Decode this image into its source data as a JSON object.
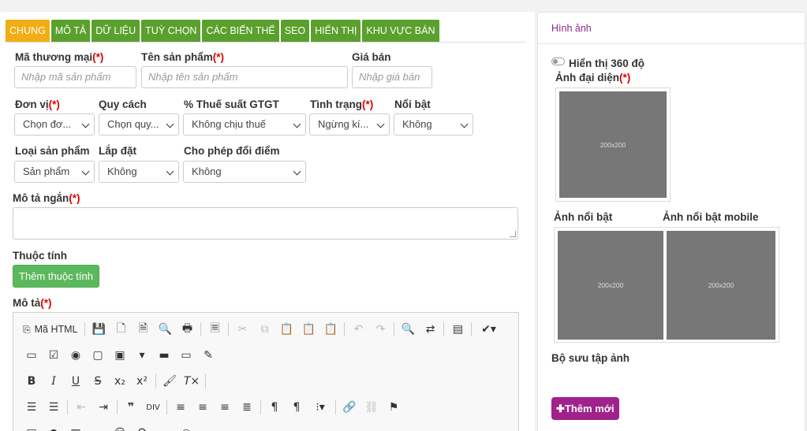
{
  "tabs": [
    {
      "label": "CHUNG"
    },
    {
      "label": "MÔ TẢ"
    },
    {
      "label": "DỮ LIỆU"
    },
    {
      "label": "TUỲ CHỌN"
    },
    {
      "label": "CÁC BIẾN THỂ"
    },
    {
      "label": "SEO"
    },
    {
      "label": "HIỂN THỊ"
    },
    {
      "label": "KHU VỰC BÁN"
    }
  ],
  "required_mark": "(*)",
  "fields": {
    "sku": {
      "label": "Mã thương mại",
      "placeholder": "Nhập mã sản phẩm"
    },
    "name": {
      "label": "Tên sản phẩm",
      "placeholder": "Nhập tên sản phẩm"
    },
    "price": {
      "label": "Giá bán",
      "placeholder": "Nhập giá bán"
    },
    "unit": {
      "label": "Đơn vị",
      "value": "Chọn đơ..."
    },
    "spec": {
      "label": "Quy cách",
      "value": "Chọn quy..."
    },
    "vat": {
      "label": "% Thuế suất GTGT",
      "value": "Không chịu thuế"
    },
    "status": {
      "label": "Tình trạng",
      "value": "Ngừng kí..."
    },
    "featured": {
      "label": "Nổi bật",
      "value": "Không"
    },
    "product_type": {
      "label": "Loại sản phẩm",
      "value": "Sản phẩm"
    },
    "install": {
      "label": "Lắp đặt",
      "value": "Không"
    },
    "points": {
      "label": "Cho phép đổi điểm",
      "value": "Không"
    },
    "short_desc": {
      "label": "Mô tả ngắn"
    },
    "attributes": {
      "label": "Thuộc tính",
      "button": "Thêm thuộc tính"
    },
    "description": {
      "label": "Mô tả"
    }
  },
  "editor": {
    "source_label": "Mã HTML"
  },
  "images": {
    "panel_title": "Hình ảnh",
    "toggle_360": "Hiển thị 360 độ",
    "avatar_label": "Ảnh đại diện",
    "featured_label": "Ảnh nổi bật",
    "featured_mobile_label": "Ảnh nổi bật mobile",
    "placeholder_text": "200x200",
    "gallery_label": "Bộ sưu tập ảnh",
    "add_button": "Thêm mới"
  },
  "colors": {
    "tab_green": "#5aa02c",
    "tab_active": "#f0ad14",
    "required": "#dd0000",
    "purple": "#a0228c"
  }
}
